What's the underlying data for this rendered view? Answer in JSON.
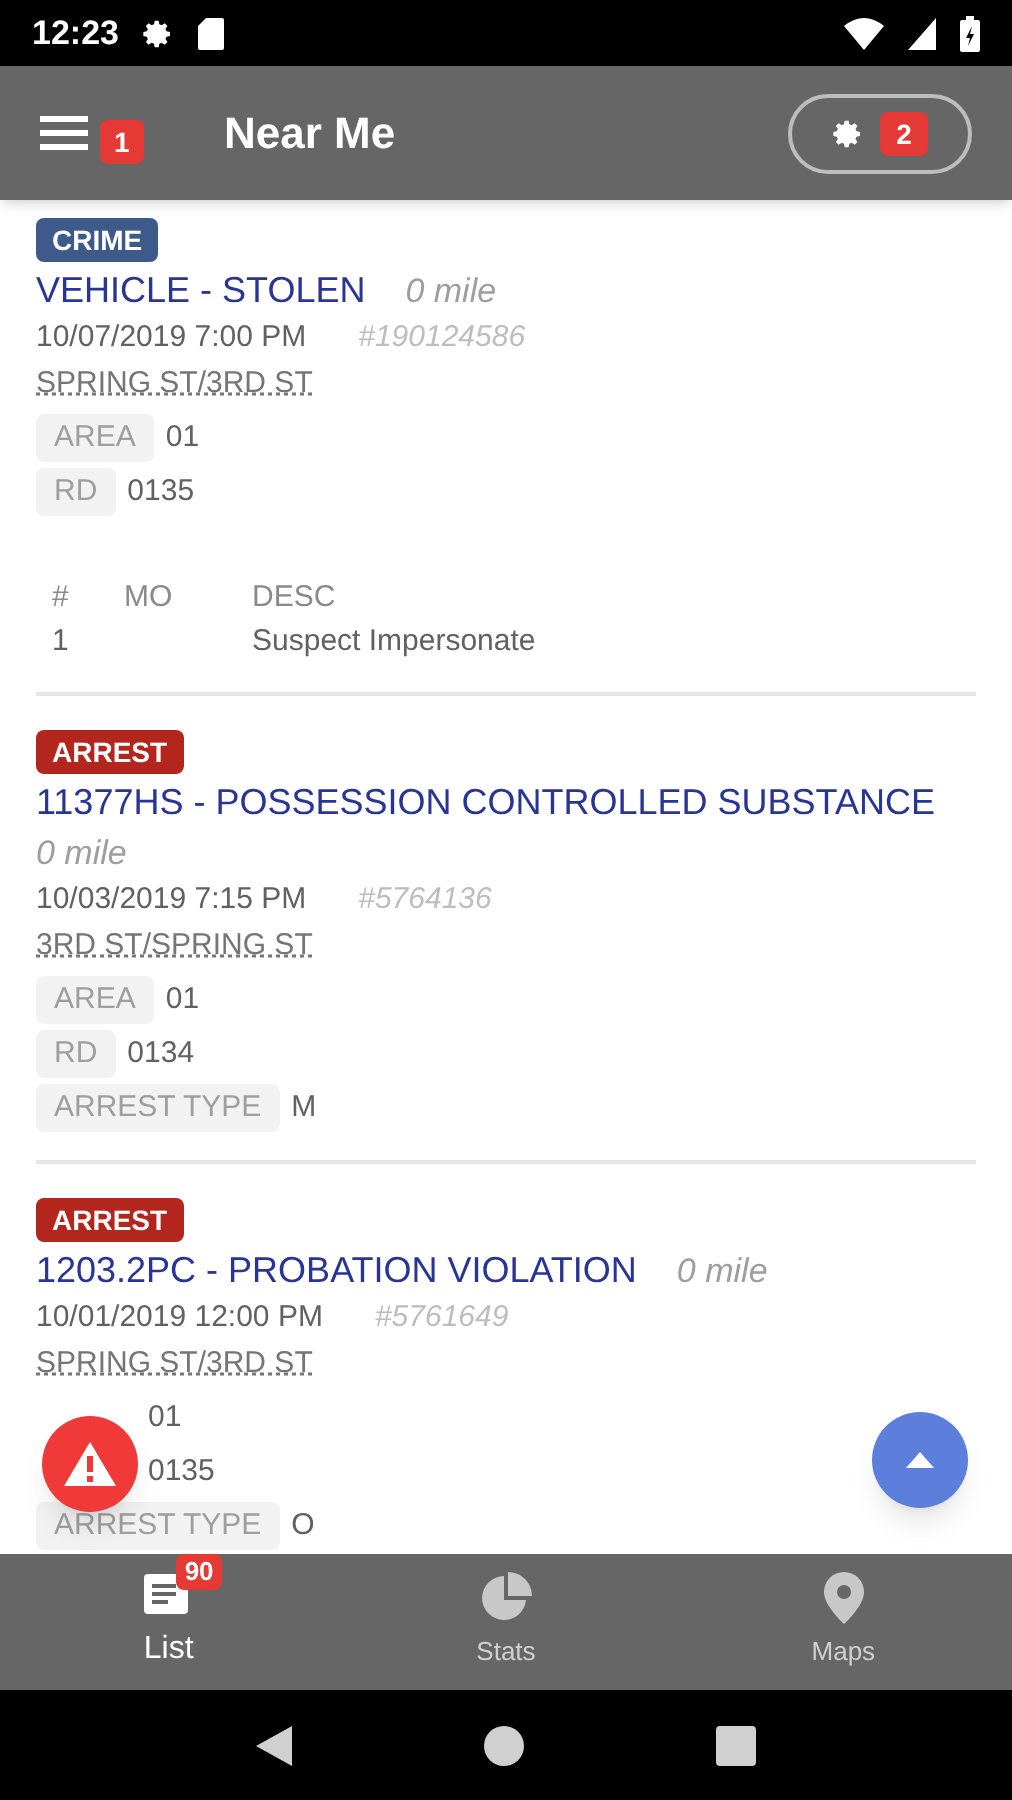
{
  "status_bar": {
    "time": "12:23"
  },
  "app_bar": {
    "title": "Near Me",
    "menu_badge": "1",
    "filter_badge": "2"
  },
  "incidents": [
    {
      "kind": "crime",
      "badge": "CRIME",
      "title": "VEHICLE - STOLEN",
      "distance": "0 mile",
      "datetime": "10/07/2019 7:00 PM",
      "number": "#190124586",
      "location": "SPRING ST/3RD ST",
      "fields": [
        {
          "label": "AREA",
          "value": "01"
        },
        {
          "label": "RD",
          "value": "0135"
        }
      ],
      "mo_table": {
        "columns": [
          "#",
          "MO",
          "DESC"
        ],
        "rows": [
          [
            "1",
            "",
            "Suspect Impersonate"
          ]
        ]
      }
    },
    {
      "kind": "arrest",
      "badge": "ARREST",
      "title": "11377HS - POSSESSION CONTROLLED SUBSTANCE",
      "distance": "0 mile",
      "datetime": "10/03/2019 7:15 PM",
      "number": "#5764136",
      "location": "3RD ST/SPRING ST",
      "fields": [
        {
          "label": "AREA",
          "value": "01"
        },
        {
          "label": "RD",
          "value": "0134"
        },
        {
          "label": "ARREST TYPE",
          "value": "M"
        }
      ]
    },
    {
      "kind": "arrest",
      "badge": "ARREST",
      "title": "1203.2PC - PROBATION VIOLATION",
      "distance": "0 mile",
      "datetime": "10/01/2019 12:00 PM",
      "number": "#5761649",
      "location": "SPRING ST/3RD ST",
      "fields": [
        {
          "value": "01"
        },
        {
          "value": "0135"
        },
        {
          "label": "ARREST TYPE",
          "value": "O"
        }
      ]
    }
  ],
  "bottom_nav": [
    {
      "label": "List",
      "badge": "90",
      "selected": true
    },
    {
      "label": "Stats",
      "selected": false
    },
    {
      "label": "Maps",
      "selected": false
    }
  ]
}
